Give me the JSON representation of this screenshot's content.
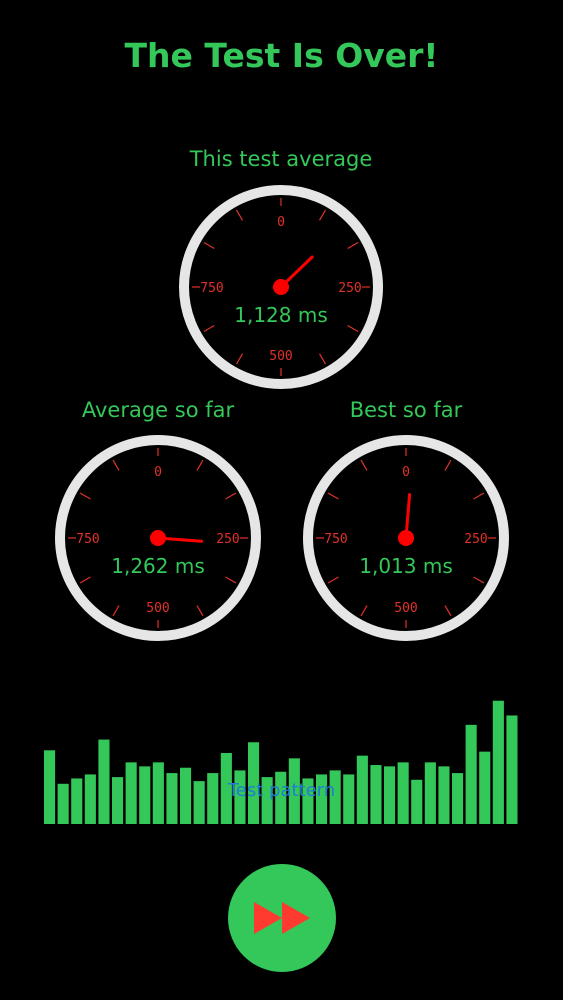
{
  "title": "The Test Is Over!",
  "gauges": [
    {
      "label": "This test average",
      "readout": "1,128 ms",
      "value_ms": 1128,
      "ticks": [
        "0",
        "250",
        "500",
        "750"
      ]
    },
    {
      "label": "Average so far",
      "readout": "1,262 ms",
      "value_ms": 1262,
      "ticks": [
        "0",
        "250",
        "500",
        "750"
      ]
    },
    {
      "label": "Best so far",
      "readout": "1,013 ms",
      "value_ms": 1013,
      "ticks": [
        "0",
        "250",
        "500",
        "750"
      ]
    }
  ],
  "pattern": {
    "label": "Test pattern",
    "levels": [
      0.55,
      0.3,
      0.34,
      0.37,
      0.63,
      0.35,
      0.46,
      0.43,
      0.46,
      0.38,
      0.42,
      0.32,
      0.38,
      0.53,
      0.4,
      0.61,
      0.35,
      0.39,
      0.49,
      0.34,
      0.37,
      0.4,
      0.37,
      0.51,
      0.44,
      0.43,
      0.46,
      0.33,
      0.46,
      0.43,
      0.38,
      0.74,
      0.54,
      0.92,
      0.81
    ]
  },
  "colors": {
    "accent": "#34c759",
    "needle": "#ff0000",
    "tick": "#e0312a",
    "dial_ring": "#e6e6e6",
    "pattern_label": "#1f7fd1"
  },
  "controls": {
    "fast_forward_icon": "fast-forward-icon"
  }
}
